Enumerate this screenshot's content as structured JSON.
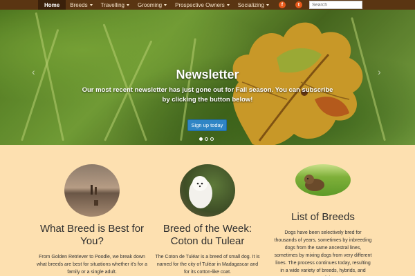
{
  "nav": {
    "items": [
      {
        "label": "Home",
        "active": true,
        "dropdown": false
      },
      {
        "label": "Breeds",
        "active": false,
        "dropdown": true
      },
      {
        "label": "Travelling",
        "active": false,
        "dropdown": true
      },
      {
        "label": "Grooming",
        "active": false,
        "dropdown": true
      },
      {
        "label": "Prospective Owners",
        "active": false,
        "dropdown": true
      },
      {
        "label": "Socializing",
        "active": false,
        "dropdown": true
      }
    ],
    "social": [
      {
        "icon": "facebook-icon",
        "glyph": "f"
      },
      {
        "icon": "twitter-icon",
        "glyph": "t"
      }
    ],
    "search_placeholder": "Search"
  },
  "hero": {
    "title": "Newsletter",
    "text": "Our most recent newsletter has just gone out for Fall season. You can subscribe by clicking the button below!",
    "button_label": "Sign up today",
    "prev_glyph": "‹",
    "next_glyph": "›"
  },
  "columns": [
    {
      "title": "What Breed is Best for You?",
      "text": "From Golden Retriever to Poodle, we break down what breeds are best for situations whether it's for a family or a single adult."
    },
    {
      "title": "Breed of the Week: Coton du Tulear",
      "text": "The Coton de Tuléar is a breed of small dog. It is named for the city of Tuléar in Madagascar and for its cotton-like coat."
    },
    {
      "title": "List of Breeds",
      "text": "Dogs have been selectively bred for thousands of years, sometimes by inbreeding dogs from the same ancestral lines, sometimes by mixing dogs from very different lines. The process continues today, resulting in a wide variety of breeds, hybrids, and types of dog."
    }
  ],
  "colors": {
    "nav_bg": "#5a3512",
    "page_bg": "#fde0b0",
    "accent": "#2f85c5",
    "social": "#e8591a"
  }
}
